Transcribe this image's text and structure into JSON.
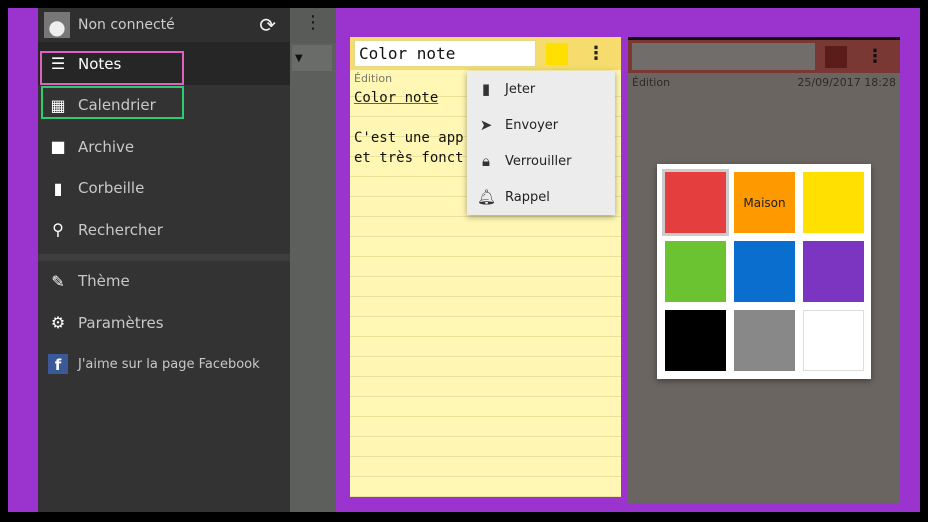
{
  "sidebar": {
    "account": "Non connecté",
    "items": [
      {
        "label": "Notes",
        "icon": "notes-icon"
      },
      {
        "label": "Calendrier",
        "icon": "calendar-icon"
      },
      {
        "label": "Archive",
        "icon": "archive-icon"
      },
      {
        "label": "Corbeille",
        "icon": "trash-icon"
      },
      {
        "label": "Rechercher",
        "icon": "search-icon"
      }
    ],
    "items2": [
      {
        "label": "Thème",
        "icon": "brush-icon"
      },
      {
        "label": "Paramètres",
        "icon": "gear-icon"
      },
      {
        "label": "J'aime sur la page Facebook",
        "icon": "facebook-icon"
      }
    ]
  },
  "note": {
    "title": "Color note",
    "color": "#ffdf00",
    "edit_label": "Édition",
    "body_title": "Color note",
    "body_line1": "C'est une app",
    "body_line2": "et très fonct"
  },
  "menu": {
    "items": [
      "Jeter",
      "Envoyer",
      "Verrouiller",
      "Rappel"
    ]
  },
  "note2": {
    "edit_label": "Édition",
    "datetime": "25/09/2017  18:28"
  },
  "picker": {
    "colors": [
      "#e53e3e",
      "#ff9900",
      "#ffe000",
      "#6cc332",
      "#0a6ecf",
      "#7c35c1",
      "#000000",
      "#888888",
      "#ffffff"
    ],
    "labels": [
      "",
      "Maison",
      "",
      "",
      "",
      "",
      "",
      "",
      ""
    ]
  }
}
